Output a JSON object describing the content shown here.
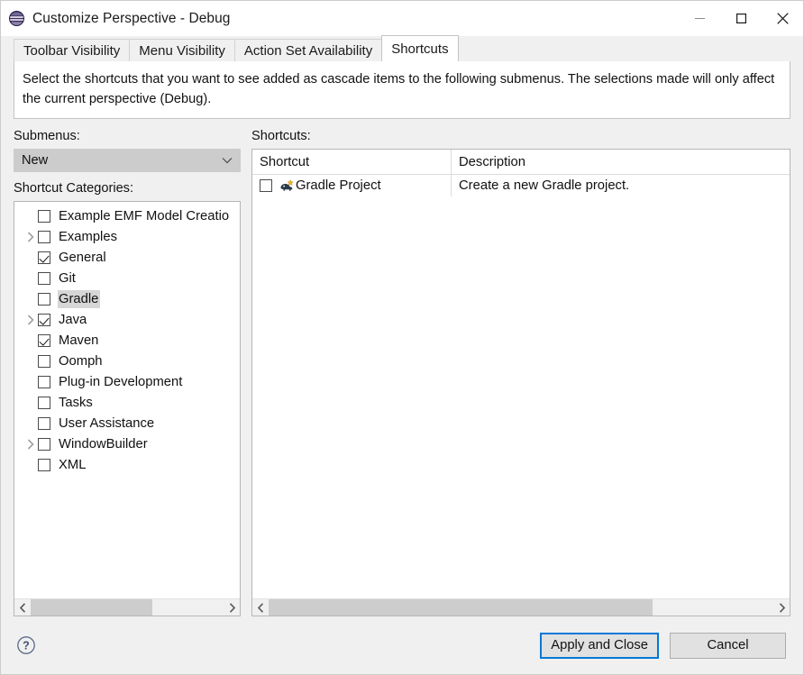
{
  "window": {
    "title": "Customize Perspective - Debug",
    "app_icon": "eclipse-icon",
    "controls": {
      "minimize": "minimize-icon",
      "maximize": "maximize-icon",
      "close": "close-icon"
    }
  },
  "tabs": [
    {
      "label": "Toolbar Visibility",
      "active": false
    },
    {
      "label": "Menu Visibility",
      "active": false
    },
    {
      "label": "Action Set Availability",
      "active": false
    },
    {
      "label": "Shortcuts",
      "active": true
    }
  ],
  "description": "Select the shortcuts that you want to see added as cascade items to the following submenus.  The selections made will only affect the current perspective (Debug).",
  "left_pane": {
    "submenus_label": "Submenus:",
    "submenu_selected": "New",
    "submenu_options": [
      "New"
    ],
    "categories_label": "Shortcut Categories:",
    "categories": [
      {
        "label": "Example EMF Model Creatio",
        "checked": false,
        "expandable": false,
        "selected": false
      },
      {
        "label": "Examples",
        "checked": false,
        "expandable": true,
        "selected": false
      },
      {
        "label": "General",
        "checked": true,
        "expandable": false,
        "selected": false
      },
      {
        "label": "Git",
        "checked": false,
        "expandable": false,
        "selected": false
      },
      {
        "label": "Gradle",
        "checked": false,
        "expandable": false,
        "selected": true
      },
      {
        "label": "Java",
        "checked": true,
        "expandable": true,
        "selected": false
      },
      {
        "label": "Maven",
        "checked": true,
        "expandable": false,
        "selected": false
      },
      {
        "label": "Oomph",
        "checked": false,
        "expandable": false,
        "selected": false
      },
      {
        "label": "Plug-in Development",
        "checked": false,
        "expandable": false,
        "selected": false
      },
      {
        "label": "Tasks",
        "checked": false,
        "expandable": false,
        "selected": false
      },
      {
        "label": "User Assistance",
        "checked": false,
        "expandable": false,
        "selected": false
      },
      {
        "label": "WindowBuilder",
        "checked": false,
        "expandable": true,
        "selected": false
      },
      {
        "label": "XML",
        "checked": false,
        "expandable": false,
        "selected": false
      }
    ]
  },
  "right_pane": {
    "shortcuts_label": "Shortcuts:",
    "columns": [
      "Shortcut",
      "Description"
    ],
    "rows": [
      {
        "checked": false,
        "icon": "gradle-project-icon",
        "name": "Gradle Project",
        "description": "Create a new Gradle project."
      }
    ]
  },
  "footer": {
    "help_icon": "help-icon",
    "apply_label": "Apply and Close",
    "cancel_label": "Cancel"
  },
  "colors": {
    "dialog_bg": "#f0f0f0",
    "focus_blue": "#0078d7",
    "selection_gray": "#d6d6d6",
    "combo_bg": "#cccccc",
    "scroll_thumb": "#cdcdcd"
  }
}
